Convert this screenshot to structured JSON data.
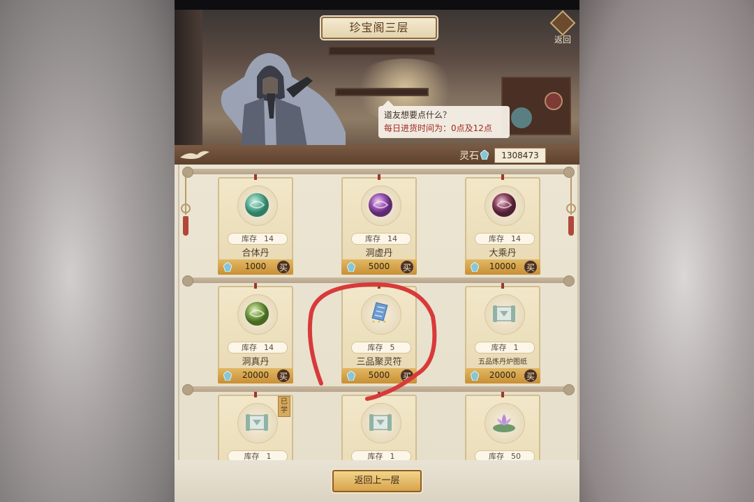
{
  "window": {
    "title": "珍宝阁三层",
    "back_label": "返回"
  },
  "npc": {
    "dialog_line1": "道友想要点什么？",
    "dialog_line2": "每日进货时间为：0点及12点"
  },
  "currency": {
    "label": "灵石",
    "amount": "1308473",
    "icon": "spirit-stone-icon",
    "color": "#86c6d6"
  },
  "shop": {
    "stock_label": "库存",
    "buy_label": "买",
    "items": [
      {
        "name": "合体丹",
        "stock": "14",
        "price": "1000",
        "icon": "green-pill-icon"
      },
      {
        "name": "洞虚丹",
        "stock": "14",
        "price": "5000",
        "icon": "purple-pill-icon"
      },
      {
        "name": "大乘丹",
        "stock": "14",
        "price": "10000",
        "icon": "maroon-pill-icon"
      },
      {
        "name": "洞真丹",
        "stock": "14",
        "price": "20000",
        "icon": "olive-pill-icon"
      },
      {
        "name": "三品聚灵符",
        "stock": "5",
        "price": "5000",
        "icon": "talisman-icon",
        "stars": 3
      },
      {
        "name": "五品炼丹炉图纸",
        "stock": "1",
        "price": "20000",
        "icon": "scroll-icon"
      },
      {
        "name": "",
        "stock": "1",
        "price": "",
        "icon": "scroll-icon",
        "badge": "已学"
      },
      {
        "name": "",
        "stock": "1",
        "price": "",
        "icon": "scroll-icon"
      },
      {
        "name": "",
        "stock": "50",
        "price": "",
        "icon": "lotus-icon"
      }
    ]
  },
  "footer": {
    "back_floor_label": "返回上一层"
  },
  "annotation": {
    "type": "hand-drawn-circle",
    "color": "#d83a3a"
  }
}
